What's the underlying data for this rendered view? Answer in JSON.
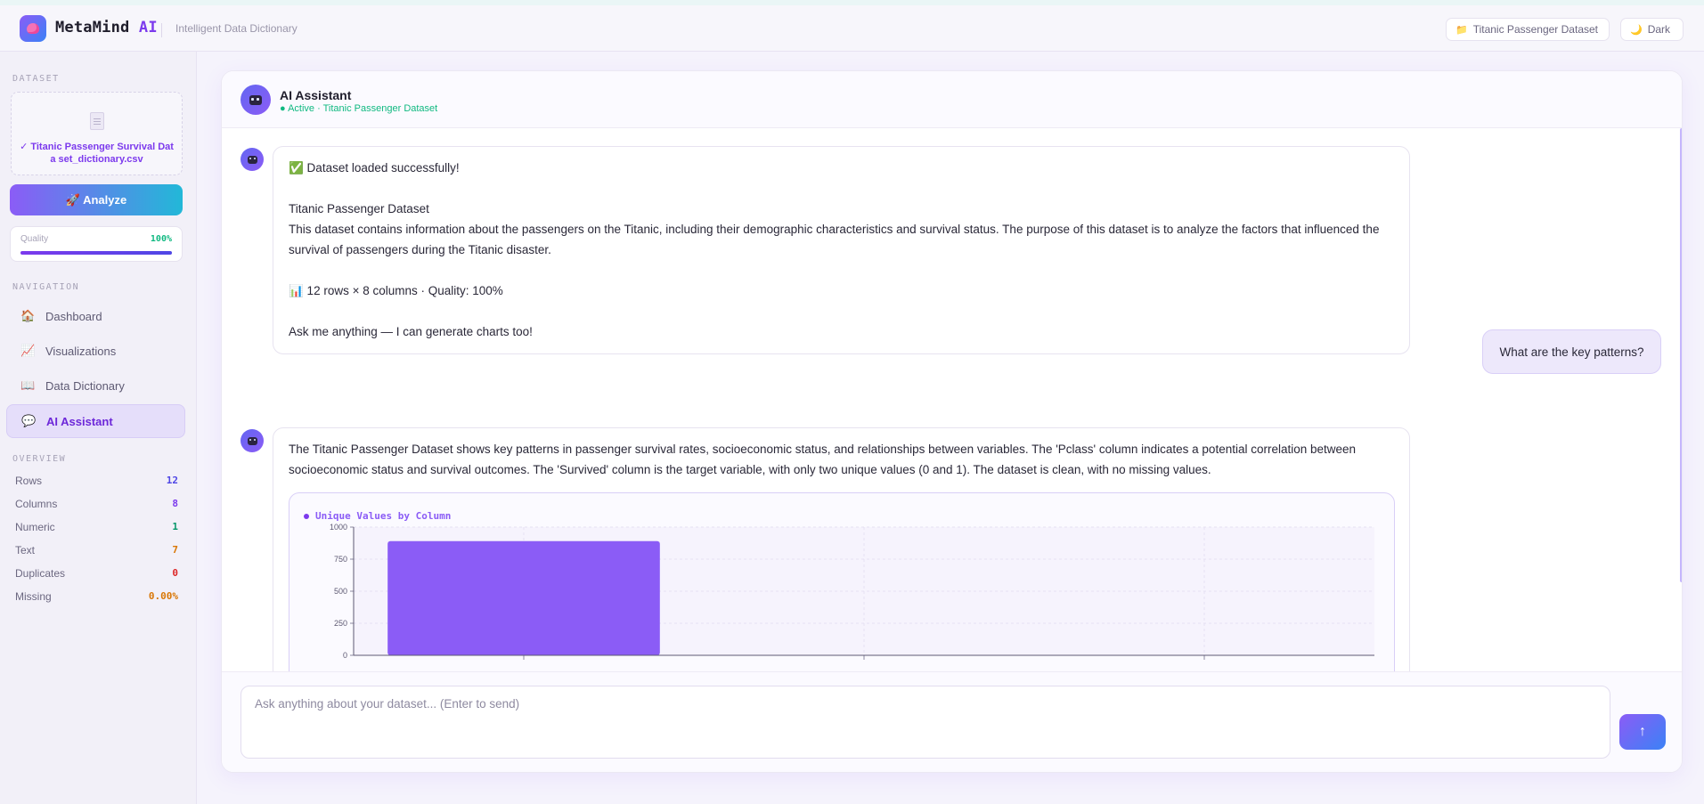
{
  "header": {
    "brand_name": "MetaMind",
    "brand_suffix": "AI",
    "tagline": "Intelligent Data Dictionary",
    "dataset_pill": "Titanic Passenger Dataset",
    "dataset_pill_icon": "folder-icon",
    "theme_pill": "Dark",
    "theme_pill_icon": "moon-icon"
  },
  "sidebar": {
    "dataset_label": "DATASET",
    "file_name": "✓ Titanic Passenger Survival Data set_dictionary.csv",
    "analyze_label": "🚀 Analyze",
    "quality_label": "Quality",
    "quality_value": "100%",
    "quality_fraction": 1.0,
    "navigation_label": "NAVIGATION",
    "nav": [
      {
        "icon": "🏠",
        "label": "Dashboard"
      },
      {
        "icon": "📈",
        "label": "Visualizations"
      },
      {
        "icon": "📖",
        "label": "Data Dictionary"
      },
      {
        "icon": "💬",
        "label": "AI Assistant"
      }
    ],
    "active_nav": "AI Assistant",
    "overview_label": "OVERVIEW",
    "overview": [
      {
        "label": "Rows",
        "value": "12",
        "color": "#4f46e5"
      },
      {
        "label": "Columns",
        "value": "8",
        "color": "#7c3aed"
      },
      {
        "label": "Numeric",
        "value": "1",
        "color": "#059669"
      },
      {
        "label": "Text",
        "value": "7",
        "color": "#d97706"
      },
      {
        "label": "Duplicates",
        "value": "0",
        "color": "#dc2626"
      },
      {
        "label": "Missing",
        "value": "0.00%",
        "color": "#d97706"
      }
    ]
  },
  "chat": {
    "title": "AI Assistant",
    "status": "● Active · Titanic Passenger Dataset",
    "messages": [
      {
        "role": "assistant",
        "lines": [
          "✅ Dataset loaded successfully!",
          "",
          "Titanic Passenger Dataset",
          "This dataset contains information about the passengers on the Titanic, including their demographic characteristics and survival status. The purpose of this dataset is to analyze the factors that influenced the survival of passengers during the Titanic disaster.",
          "",
          "📊 12 rows × 8 columns · Quality: 100%",
          "",
          "Ask me anything — I can generate charts too!"
        ]
      },
      {
        "role": "user",
        "text": "What are the key patterns?"
      },
      {
        "role": "assistant",
        "text": "The Titanic Passenger Dataset shows key patterns in passenger survival rates, socioeconomic status, and relationships between variables. The 'Pclass' column indicates a potential correlation between socioeconomic status and survival outcomes. The 'Survived' column is the target variable, with only two unique values (0 and 1). The dataset is clean, with no missing values."
      }
    ],
    "composer_placeholder": "Ask anything about your dataset... (Enter to send)",
    "send_icon": "arrow-up-icon"
  },
  "chart_data": {
    "type": "bar",
    "title": "Unique Values by Column",
    "ylim": [
      0,
      1000
    ],
    "yticks": [
      0,
      250,
      500,
      750,
      1000
    ],
    "categories": [
      "",
      "",
      ""
    ],
    "values": [
      891,
      0,
      0
    ],
    "colors": {
      "bar": "#8b5cf6",
      "accent": "#7c3aed"
    }
  }
}
